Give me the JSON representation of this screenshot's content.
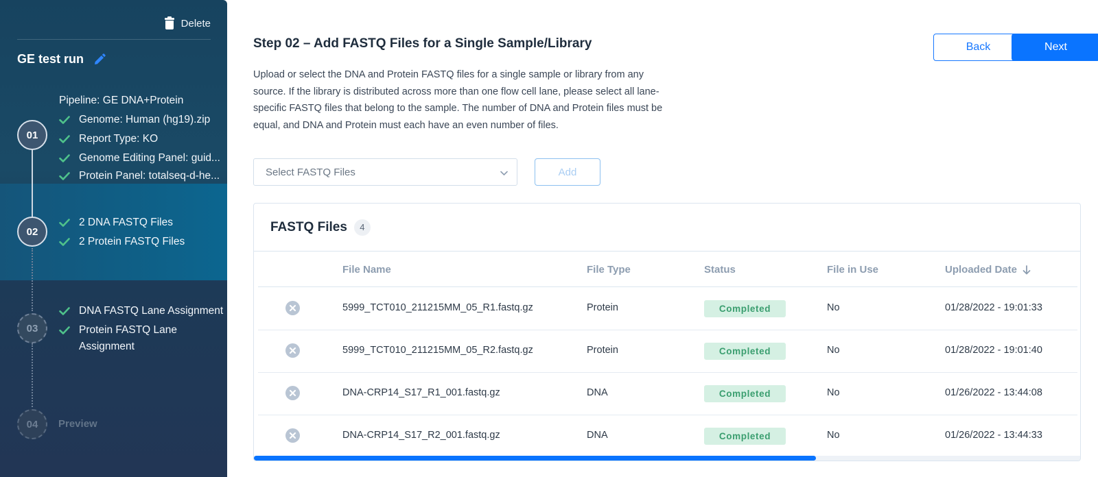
{
  "sidebar": {
    "delete_label": "Delete",
    "run_name": "GE test run",
    "steps": [
      {
        "number": "01",
        "items": [
          "Pipeline: GE DNA+Protein",
          "Genome: Human (hg19).zip",
          "Report Type: KO",
          "Genome Editing Panel: guid...",
          "Protein Panel: totalseq-d-he..."
        ]
      },
      {
        "number": "02",
        "items": [
          "2 DNA FASTQ Files",
          "2 Protein FASTQ Files"
        ]
      },
      {
        "number": "03",
        "items": [
          "DNA FASTQ Lane Assignment",
          "Protein FASTQ Lane Assignment"
        ]
      },
      {
        "number": "04",
        "label": "Preview"
      }
    ]
  },
  "main": {
    "title": "Step 02 – Add FASTQ Files for a Single Sample/Library",
    "description": "Upload or select the DNA and Protein FASTQ files for a single sample or library from any source. If the library is distributed across more than one flow cell lane, please select all lane-specific FASTQ files that belong to the sample. The number of DNA and Protein files must be equal, and DNA and Protein must each have an even number of files.",
    "back_label": "Back",
    "next_label": "Next",
    "select_placeholder": "Select FASTQ Files",
    "add_label": "Add"
  },
  "table": {
    "title": "FASTQ Files",
    "count": "4",
    "columns": [
      "File Name",
      "File Type",
      "Status",
      "File in Use",
      "Uploaded Date"
    ],
    "rows": [
      {
        "file_name": "5999_TCT010_211215MM_05_R1.fastq.gz",
        "file_type": "Protein",
        "status": "Completed",
        "in_use": "No",
        "uploaded": "01/28/2022 - 19:01:33"
      },
      {
        "file_name": "5999_TCT010_211215MM_05_R2.fastq.gz",
        "file_type": "Protein",
        "status": "Completed",
        "in_use": "No",
        "uploaded": "01/28/2022 - 19:01:40"
      },
      {
        "file_name": "DNA-CRP14_S17_R1_001.fastq.gz",
        "file_type": "DNA",
        "status": "Completed",
        "in_use": "No",
        "uploaded": "01/26/2022 - 13:44:08"
      },
      {
        "file_name": "DNA-CRP14_S17_R2_001.fastq.gz",
        "file_type": "DNA",
        "status": "Completed",
        "in_use": "No",
        "uploaded": "01/26/2022 - 13:44:33"
      }
    ],
    "scroll_fraction": 0.68
  },
  "colors": {
    "accent": "#0a74ff",
    "success": "#4fc28b",
    "badge_bg": "#d5f0e3",
    "badge_text": "#3a9e6f"
  },
  "icons": {
    "delete": "trash-icon",
    "edit": "pencil-icon",
    "done": "check-icon",
    "remove": "remove-circle-icon",
    "dropdown": "chevron-down-icon",
    "sort": "arrow-down-icon"
  }
}
